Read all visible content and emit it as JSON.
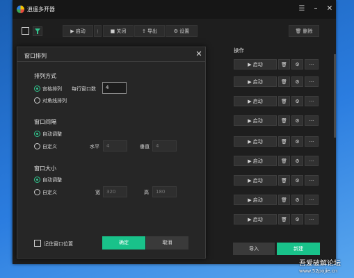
{
  "app": {
    "title": "逍遥多开器",
    "window_controls": {
      "menu": "☰",
      "minimize": "–",
      "close": "✕"
    }
  },
  "toolbar": {
    "start_label": "▶ 启动",
    "close_label": "■ 关闭",
    "export_label": "⇪ 导出",
    "settings_label": "⚙ 设置",
    "delete_label": "🗑 删除"
  },
  "table": {
    "column_header": "操作",
    "rows": [
      {
        "start": "▶ 启动"
      },
      {
        "start": "▶ 启动"
      },
      {
        "start": "▶ 启动"
      },
      {
        "start": "▶ 启动"
      },
      {
        "start": "▶ 启动"
      },
      {
        "start": "▶ 启动"
      },
      {
        "start": "▶ 启动"
      },
      {
        "start": "▶ 启动"
      },
      {
        "start": "▶ 启动"
      },
      {
        "start": "▶ 启动"
      }
    ],
    "row_icons": {
      "delete": "🗑",
      "settings": "⚙",
      "more": "···"
    }
  },
  "bottom": {
    "import_label": "导入",
    "new_label": "新建"
  },
  "dialog": {
    "title": "窗口排列",
    "close_icon": "✕",
    "arrange": {
      "section_title": "排列方式",
      "grid_label": "宫格排列",
      "per_row_label": "每行窗口数",
      "per_row_value": "4",
      "diagonal_label": "对角线排列",
      "selected": "grid"
    },
    "spacing": {
      "section_title": "窗口间隔",
      "auto_label": "自动调整",
      "custom_label": "自定义",
      "horizontal_label": "水平",
      "horizontal_value": "4",
      "vertical_label": "垂直",
      "vertical_value": "4",
      "selected": "auto"
    },
    "size": {
      "section_title": "窗口大小",
      "auto_label": "自动调整",
      "custom_label": "自定义",
      "width_label": "宽",
      "width_value": "320",
      "height_label": "高",
      "height_value": "180",
      "selected": "auto"
    },
    "remember_label": "记住窗口位置",
    "confirm_label": "确定",
    "cancel_label": "取消"
  },
  "watermark": {
    "text": "吾爱破解论坛",
    "url": "www.52pojie.cn"
  },
  "colors": {
    "accent": "#19c28a",
    "window_bg": "#1e1e1e",
    "titlebar_bg": "#161616",
    "dialog_bg": "#262626",
    "desktop": "#2b7de0"
  }
}
